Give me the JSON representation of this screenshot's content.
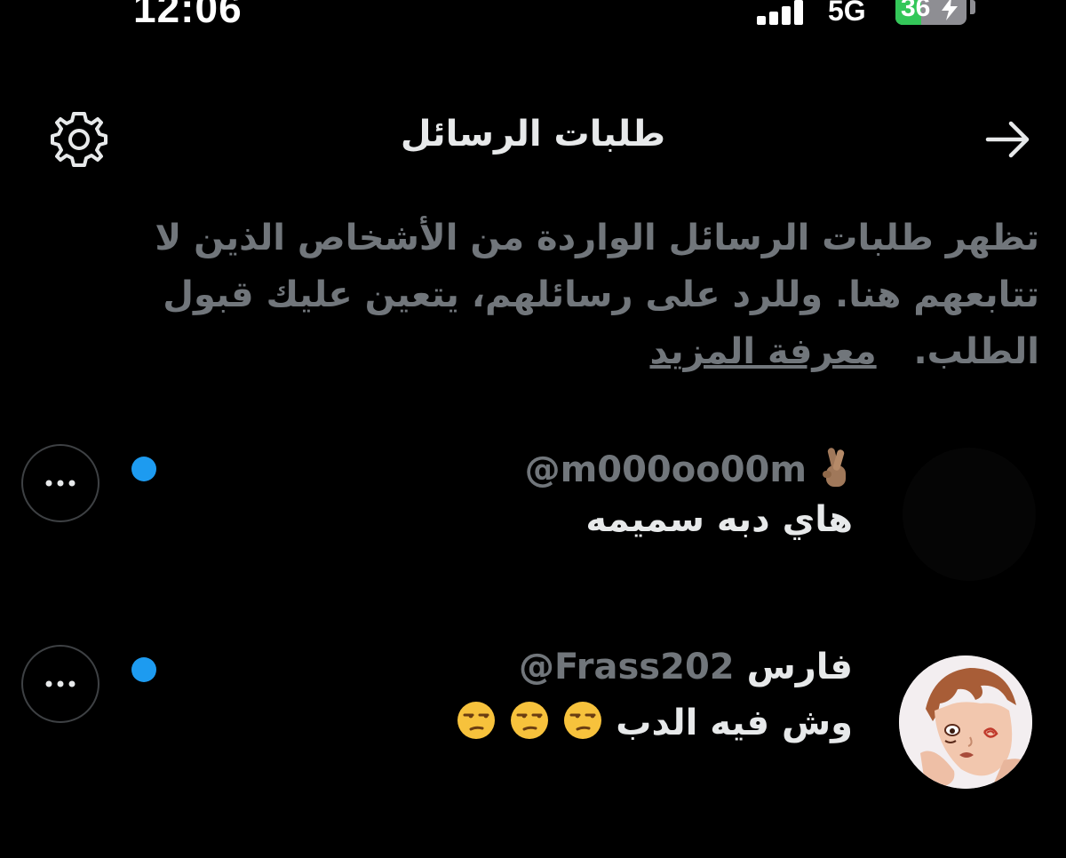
{
  "status_bar": {
    "time": "12:06",
    "network": "5G",
    "battery": "36",
    "battery_level": 0.36
  },
  "header": {
    "title": "طلبات الرسائل",
    "settings_icon": "gear-icon",
    "back_icon": "arrow-right-icon"
  },
  "info": {
    "text": "تظهر طلبات الرسائل الواردة من الأشخاص الذين لا تتابعهم هنا. وللرد على رسائلهم، يتعين عليك قبول الطلب.",
    "link": "معرفة المزيد"
  },
  "requests": [
    {
      "name": "",
      "handle": "@m000oo00m",
      "name_emoji": "crossed-fingers",
      "message": "هاي دبه سميمه",
      "unread": true,
      "more_icon": "more-horizontal-icon"
    },
    {
      "name": "فارس",
      "handle": "@Frass202",
      "message": "وش فيه الدب",
      "message_emojis": [
        "unamused-face",
        "unamused-face",
        "unamused-face"
      ],
      "unread": true,
      "more_icon": "more-horizontal-icon"
    }
  ],
  "colors": {
    "background": "#000000",
    "text_primary": "#e7e9ea",
    "text_secondary": "#71767b",
    "accent_blue": "#1d9bf0",
    "battery_green": "#34c759"
  }
}
